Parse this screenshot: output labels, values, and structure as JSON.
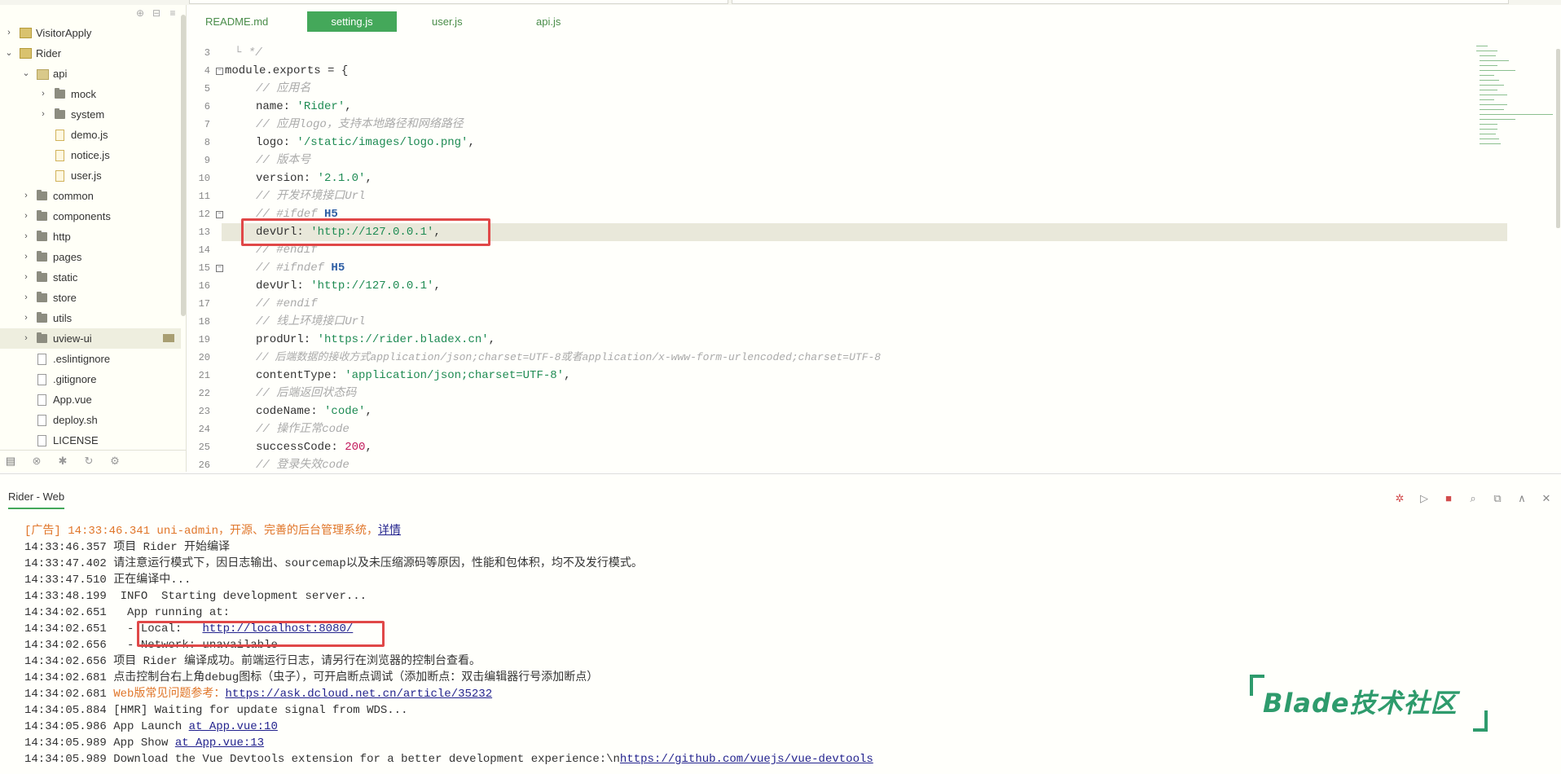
{
  "sidebar": {
    "items": [
      {
        "label": "VisitorApply"
      },
      {
        "label": "Rider"
      },
      {
        "label": "api"
      },
      {
        "label": "mock"
      },
      {
        "label": "system"
      },
      {
        "label": "demo.js"
      },
      {
        "label": "notice.js"
      },
      {
        "label": "user.js"
      },
      {
        "label": "common"
      },
      {
        "label": "components"
      },
      {
        "label": "http"
      },
      {
        "label": "pages"
      },
      {
        "label": "static"
      },
      {
        "label": "store"
      },
      {
        "label": "utils"
      },
      {
        "label": "uview-ui"
      },
      {
        "label": ".eslintignore"
      },
      {
        "label": ".gitignore"
      },
      {
        "label": "App.vue"
      },
      {
        "label": "deploy.sh"
      },
      {
        "label": "LICENSE"
      }
    ]
  },
  "editor": {
    "tabs": [
      {
        "label": "README.md"
      },
      {
        "label": "setting.js"
      },
      {
        "label": "user.js"
      },
      {
        "label": "api.js"
      }
    ],
    "line_numbers": [
      "3",
      "4",
      "5",
      "6",
      "7",
      "8",
      "9",
      "10",
      "11",
      "12",
      "13",
      "14",
      "15",
      "16",
      "17",
      "18",
      "19",
      "20",
      "21",
      "22",
      "23",
      "24",
      "25",
      "26"
    ],
    "lines": {
      "l3": "└ */",
      "l4": "module.exports = {",
      "l5": "// 应用名",
      "l6a": "name: ",
      "l6b": "'Rider'",
      "l6c": ",",
      "l7": "// 应用logo，支持本地路径和网络路径",
      "l8a": "logo: ",
      "l8b": "'/static/images/logo.png'",
      "l8c": ",",
      "l9": "// 版本号",
      "l10a": "version: ",
      "l10b": "'2.1.0'",
      "l10c": ",",
      "l11": "// 开发环境接口Url",
      "l12a": "// #ifdef ",
      "l12b": "H5",
      "l13a": "devUrl: ",
      "l13b": "'http://127.0.0.1'",
      "l13c": ",",
      "l14": "// #endif",
      "l15a": "// #ifndef ",
      "l15b": "H5",
      "l16a": "devUrl: ",
      "l16b": "'http://127.0.0.1'",
      "l16c": ",",
      "l17": "// #endif",
      "l18": "// 线上环境接口Url",
      "l19a": "prodUrl: ",
      "l19b": "'https://rider.bladex.cn'",
      "l19c": ",",
      "l20": "// 后端数据的接收方式application/json;charset=UTF-8或者application/x-www-form-urlencoded;charset=UTF-8",
      "l21a": "contentType: ",
      "l21b": "'application/json;charset=UTF-8'",
      "l21c": ",",
      "l22": "// 后端返回状态码",
      "l23a": "codeName: ",
      "l23b": "'code'",
      "l23c": ",",
      "l24": "// 操作正常code",
      "l25a": "successCode: ",
      "l25b": "200",
      "l25c": ",",
      "l26": "// 登录失效code"
    }
  },
  "console": {
    "tab_label": "Rider - Web",
    "log": {
      "ad_prefix": "[广告] 14:33:46.341 uni-admin，开源、完善的后台管理系统，",
      "ad_link": "详情",
      "l2": "14:33:46.357 项目 Rider 开始编译",
      "l3": "14:33:47.402 请注意运行模式下，因日志输出、sourcemap以及未压缩源码等原因，性能和包体积，均不及发行模式。",
      "l4": "14:33:47.510 正在编译中...",
      "l5": "14:33:48.199  INFO  Starting development server...",
      "l6": "14:34:02.651   App running at:",
      "l7_prefix": "14:34:02.651   - Local:   ",
      "l7_link": "http://localhost:8080/",
      "l8": "14:34:02.656   - Network: unavailable",
      "l9": "14:34:02.656 项目 Rider 编译成功。前端运行日志，请另行在浏览器的控制台查看。",
      "l10": "14:34:02.681 点击控制台右上角debug图标（虫子），可开启断点调试（添加断点：双击编辑器行号添加断点）",
      "l11_time": "14:34:02.681 ",
      "l11_text": "Web版常见问题参考：",
      "l11_link": "https://ask.dcloud.net.cn/article/35232",
      "l12": "14:34:05.884 [HMR] Waiting for update signal from WDS...",
      "l13_prefix": "14:34:05.986 App Launch ",
      "l13_link": "at App.vue:10",
      "l14_prefix": "14:34:05.989 App Show ",
      "l14_link": "at App.vue:13",
      "l15_prefix": "14:34:05.989 Download the Vue Devtools extension for a better development experience:\\n",
      "l15_link": "https://github.com/vuejs/vue-devtools"
    }
  },
  "watermark": {
    "text": "Blade技术社区"
  },
  "colors": {
    "accent": "#44a85a",
    "highlight_box": "#e04848",
    "string": "#1e8b53",
    "comment": "#aaaaaa",
    "number": "#c2185b"
  }
}
